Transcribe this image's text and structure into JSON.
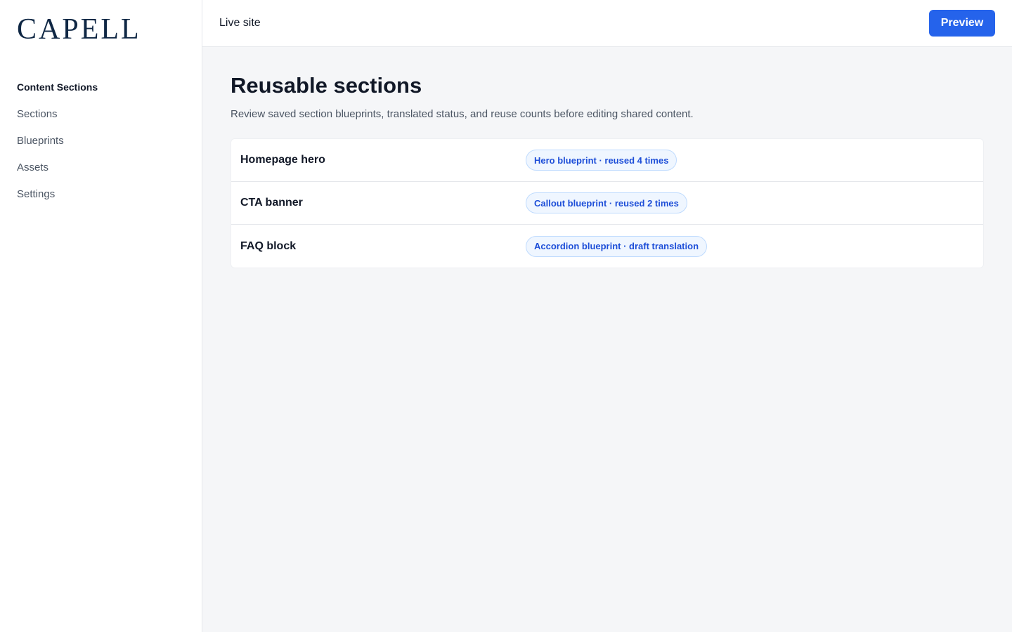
{
  "brand": {
    "logo": "CAPELL"
  },
  "sidebar": {
    "heading": "Content Sections",
    "items": [
      {
        "label": "Sections"
      },
      {
        "label": "Blueprints"
      },
      {
        "label": "Assets"
      },
      {
        "label": "Settings"
      }
    ]
  },
  "topbar": {
    "live_site": "Live site",
    "preview_label": "Preview"
  },
  "page": {
    "title": "Reusable sections",
    "description": "Review saved section blueprints, translated status, and reuse counts before editing shared content."
  },
  "sections": [
    {
      "name": "Homepage hero",
      "badge": "Hero blueprint · reused 4 times"
    },
    {
      "name": "CTA banner",
      "badge": "Callout blueprint · reused 2 times"
    },
    {
      "name": "FAQ block",
      "badge": "Accordion blueprint · draft translation"
    }
  ],
  "colors": {
    "accent": "#2563eb",
    "badge_text": "#1d4ed8",
    "badge_bg": "#eff6ff",
    "logo": "#0f2744"
  }
}
